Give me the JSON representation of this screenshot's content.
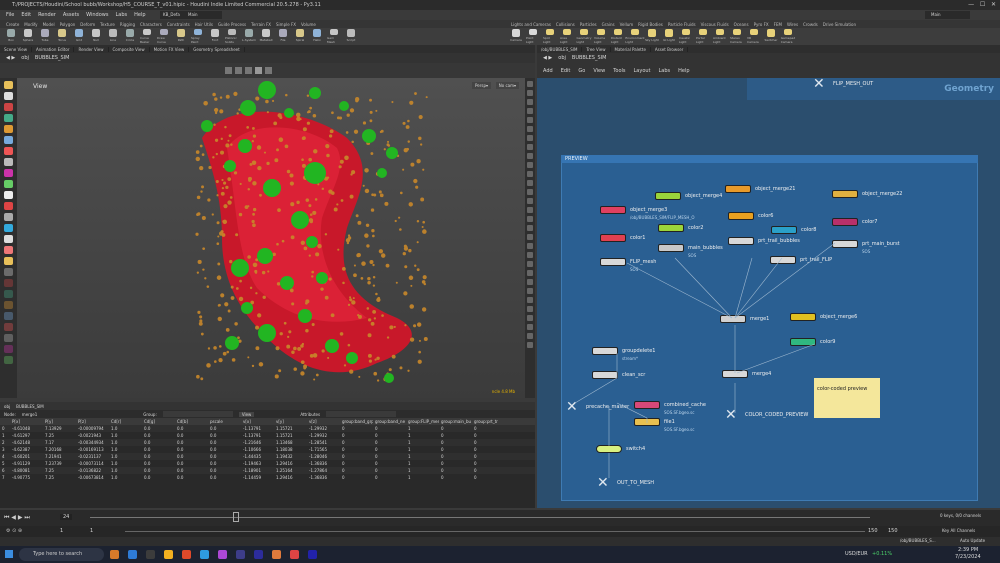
{
  "window": {
    "title": "T:/PROJECTS/Houdini/School bubb/Workshop/H5_COURSE_T_v01.hipic - Houdini Indie Limited Commercial 20.5.278 - Py3.11"
  },
  "menu": [
    "File",
    "Edit",
    "Render",
    "Assets",
    "Windows",
    "Labs",
    "Help"
  ],
  "desktop": {
    "label": "KB_Default",
    "main": "Main"
  },
  "shelf": {
    "tabs": [
      "Create",
      "Modify",
      "Model",
      "Polygon",
      "Deform",
      "Texture",
      "Rigging",
      "Characters",
      "Constraints",
      "Hair Utils",
      "Guide Process",
      "Terrain FX",
      "Simple FX",
      "Volume"
    ],
    "right_tabs": [
      "Lights and Cameras",
      "Collisions",
      "Particles",
      "Grains",
      "Vellum",
      "Rigid Bodies",
      "Particle Fluids",
      "Viscous Fluids",
      "Oceans",
      "Pyro FX",
      "FEM",
      "Wires",
      "Crowds",
      "Drive Simulation"
    ],
    "tools": [
      "Box",
      "Sphere",
      "Tube",
      "Torus",
      "Grid",
      "Null",
      "Line",
      "Circle",
      "Curve Bezier",
      "Draw Curve",
      "Path",
      "Spray Paint",
      "Font",
      "Platonic Solids",
      "L-System",
      "Metaball",
      "File",
      "Spiral",
      "Helix",
      "Gem Mesh",
      "Script"
    ],
    "right_tools": [
      "Camera",
      "Point Light",
      "Spot Light",
      "Area Light",
      "Geometry Light",
      "Volume Light",
      "Distant Light",
      "Environment Light",
      "Sky Light",
      "GI Light",
      "Caustic Light",
      "Portal Light",
      "Ambient Light",
      "Stereo Camera",
      "VR Camera",
      "Switcher",
      "Gamepad Camera"
    ]
  },
  "pane_tabs": {
    "left": [
      "Scene View",
      "Animation Editor",
      "Render View",
      "Composite View",
      "Motion FX View",
      "Geometry Spreadsheet"
    ],
    "right": [
      "/obj/BUBBLES_SIM",
      "Tree View",
      "Material Palette",
      "Asset Browser"
    ]
  },
  "viewport": {
    "path_obj": "obj",
    "path_node": "BUBBLES_SIM",
    "label": "View",
    "persp": "Persp▾",
    "cam": "No cam▾",
    "stats": "ncle 4.8 Mb"
  },
  "network": {
    "path_obj": "obj",
    "path_node": "BUBBLES_SIM",
    "menu": [
      "Add",
      "Edit",
      "Go",
      "View",
      "Tools",
      "Layout",
      "Labs",
      "Help"
    ],
    "context": "Geometry",
    "box_title": "PREVIEW",
    "nodes": [
      {
        "name": "FLIP_MESH_OUT",
        "sub": ""
      },
      {
        "name": "object_merge4",
        "sub": ""
      },
      {
        "name": "object_merge3",
        "sub": "/obj/BUBBLES_SIM/FLIP_MESH_O"
      },
      {
        "name": "object_merge21",
        "sub": ""
      },
      {
        "name": "object_merge22",
        "sub": ""
      },
      {
        "name": "color1",
        "sub": ""
      },
      {
        "name": "color2",
        "sub": ""
      },
      {
        "name": "color6",
        "sub": ""
      },
      {
        "name": "color7",
        "sub": ""
      },
      {
        "name": "color8",
        "sub": ""
      },
      {
        "name": "main_bubbles",
        "sub": "SOS"
      },
      {
        "name": "prt_trail_bubbles",
        "sub": ""
      },
      {
        "name": "prt_main_burst",
        "sub": "SOS"
      },
      {
        "name": "FLIP_mesh",
        "sub": "SOS"
      },
      {
        "name": "prt_trail_FLIP",
        "sub": ""
      },
      {
        "name": "merge1",
        "sub": ""
      },
      {
        "name": "object_merge6",
        "sub": ""
      },
      {
        "name": "color9",
        "sub": ""
      },
      {
        "name": "groupdelete1",
        "sub": "stream*"
      },
      {
        "name": "clean_scr",
        "sub": ""
      },
      {
        "name": "merge4",
        "sub": ""
      },
      {
        "name": "precache_master",
        "sub": ""
      },
      {
        "name": "combined_cache",
        "sub": "SOS.SF.bgeo.sc"
      },
      {
        "name": "file1",
        "sub": "SOS.SF.bgeo.sc"
      },
      {
        "name": "COLOR_CODED_PREVIEW",
        "sub": ""
      },
      {
        "name": "switch4",
        "sub": ""
      },
      {
        "name": "OUT_TO_MESH",
        "sub": ""
      }
    ],
    "sticky": "color-coded preview"
  },
  "spreadsheet": {
    "node": "merge1",
    "group_label": "Group:",
    "view": "View",
    "attrib": "Attributes",
    "columns": [
      "",
      "P[x]",
      "P[y]",
      "P[z]",
      "Cd[r]",
      "Cd[g]",
      "Cd[b]",
      "pscale",
      "v[x]",
      "v[y]",
      "v[z]",
      "group:band_grp",
      "group:band_ne",
      "group:FLIP_mes",
      "group:main_bu",
      "group:prt_tr"
    ],
    "rows": [
      [
        "0",
        "-4.61048",
        "7.13929",
        "-0.00009794",
        "1.0",
        "0.0",
        "0.0",
        "0.0",
        "-1.13791",
        "1.15721",
        "-1.29932",
        "0",
        "0",
        "1",
        "0",
        "0"
      ],
      [
        "1",
        "-4.61297",
        "7.25",
        "-0.0021943",
        "1.0",
        "0.0",
        "0.0",
        "0.0",
        "-1.13791",
        "1.15721",
        "-1.29932",
        "0",
        "0",
        "1",
        "0",
        "0"
      ],
      [
        "2",
        "-4.62148",
        "7.17",
        "-0.00344934",
        "1.0",
        "0.0",
        "0.0",
        "0.0",
        "-1.21646",
        "1.13468",
        "-1.28541",
        "0",
        "0",
        "1",
        "0",
        "0"
      ],
      [
        "3",
        "-4.62387",
        "7.20168",
        "-0.00169113",
        "1.0",
        "0.0",
        "0.0",
        "0.0",
        "-1.10666",
        "1.18038",
        "-1.71565",
        "0",
        "0",
        "1",
        "0",
        "0"
      ],
      [
        "4",
        "-4.60201",
        "7.21941",
        "-0.0231137",
        "1.0",
        "0.0",
        "0.0",
        "0.0",
        "-1.44435",
        "1.19432",
        "-1.28046",
        "0",
        "0",
        "1",
        "0",
        "0"
      ],
      [
        "5",
        "-4.91129",
        "7.23739",
        "-0.00073114",
        "1.0",
        "0.0",
        "0.0",
        "0.0",
        "-1.19463",
        "1.29416",
        "-1.36836",
        "0",
        "0",
        "1",
        "0",
        "0"
      ],
      [
        "6",
        "-4.80081",
        "7.25",
        "-0.0136822",
        "1.0",
        "0.0",
        "0.0",
        "0.0",
        "-1.18901",
        "1.25164",
        "-1.27864",
        "0",
        "0",
        "1",
        "0",
        "0"
      ],
      [
        "7",
        "-4.90775",
        "7.25",
        "-0.00673814",
        "1.0",
        "0.0",
        "0.0",
        "0.0",
        "-1.14459",
        "1.29416",
        "-1.36836",
        "0",
        "0",
        "1",
        "0",
        "0"
      ]
    ]
  },
  "timeline": {
    "frame": "24",
    "start": "1",
    "end": "1",
    "range_end": "150",
    "range_end2": "150",
    "keys": "0 keys, 0/0 channels",
    "key_all": "Key All Channels",
    "auto": "Auto Update",
    "path": "/obj/BUBBLES_S..."
  },
  "taskbar": {
    "search": "Type here to search",
    "currency": "USD/EUR",
    "change": "+0.11%",
    "time": "2:39 PM",
    "date": "7/23/2024"
  }
}
